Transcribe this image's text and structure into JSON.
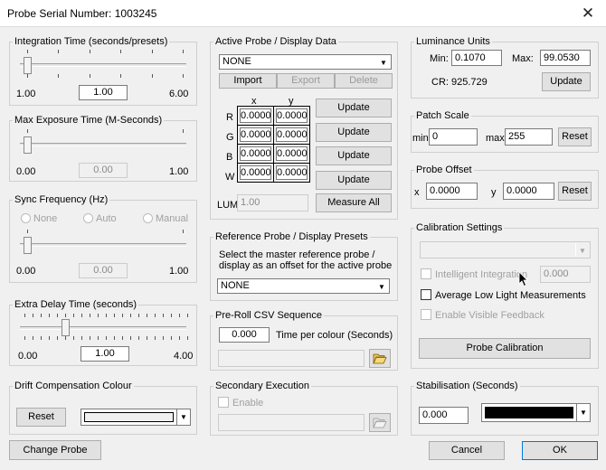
{
  "window": {
    "title": "Probe Serial Number: 1003245",
    "close_glyph": "✕"
  },
  "integration": {
    "legend": "Integration Time (seconds/presets)",
    "min": "1.00",
    "value": "1.00",
    "max": "6.00",
    "level": 0
  },
  "exposure": {
    "legend": "Max Exposure Time (M-Seconds)",
    "min": "0.00",
    "value": "0.00",
    "max": "1.00",
    "level": 0
  },
  "sync": {
    "legend": "Sync Frequency (Hz)",
    "options": [
      "None",
      "Auto",
      "Manual"
    ],
    "min": "0.00",
    "value": "0.00",
    "max": "1.00",
    "level": 0
  },
  "extra_delay": {
    "legend": "Extra Delay Time (seconds)",
    "min": "0.00",
    "value": "1.00",
    "max": "4.00",
    "level": 0.25
  },
  "drift": {
    "legend": "Drift Compensation Colour",
    "reset": "Reset"
  },
  "change_probe": "Change Probe",
  "active_probe": {
    "legend": "Active Probe / Display Data",
    "selected": "NONE",
    "import": "Import",
    "export": "Export",
    "delete": "Delete",
    "col_x": "x",
    "col_y": "y",
    "rows": [
      {
        "label": "R",
        "x": "0.0000",
        "y": "0.0000",
        "button": "Update"
      },
      {
        "label": "G",
        "x": "0.0000",
        "y": "0.0000",
        "button": "Update"
      },
      {
        "label": "B",
        "x": "0.0000",
        "y": "0.0000",
        "button": "Update"
      },
      {
        "label": "W",
        "x": "0.0000",
        "y": "0.0000",
        "button": "Update"
      }
    ],
    "lum_label": "LUM",
    "lum_value": "1.00",
    "measure_all": "Measure All"
  },
  "reference": {
    "legend": "Reference Probe / Display Presets",
    "description": [
      "Select the master reference probe /",
      "display as an offset for the active probe"
    ],
    "selected": "NONE"
  },
  "preroll": {
    "legend": "Pre-Roll CSV Sequence",
    "value": "0.000",
    "label": "Time per colour (Seconds)"
  },
  "secondary": {
    "legend": "Secondary Execution",
    "enable": "Enable"
  },
  "luminance": {
    "legend": "Luminance Units",
    "min_label": "Min:",
    "min": "0.1070",
    "max_label": "Max:",
    "max": "99.0530",
    "cr": "CR: 925.729",
    "update": "Update"
  },
  "patch": {
    "legend": "Patch Scale",
    "min_label": "min",
    "min": "0",
    "max_label": "max",
    "max": "255",
    "reset": "Reset"
  },
  "offset": {
    "legend": "Probe Offset",
    "x_label": "x",
    "x": "0.0000",
    "y_label": "y",
    "y": "0.0000",
    "reset": "Reset"
  },
  "calibration": {
    "legend": "Calibration Settings",
    "intelligent": "Intelligent Integration",
    "intelligent_value": "0.000",
    "average": "Average Low Light Measurements",
    "visible": "Enable Visible Feedback",
    "button": "Probe Calibration"
  },
  "stabilisation": {
    "legend": "Stabilisation (Seconds)",
    "value": "0.000",
    "colour": "#000000"
  },
  "footer": {
    "cancel": "Cancel",
    "ok": "OK"
  }
}
